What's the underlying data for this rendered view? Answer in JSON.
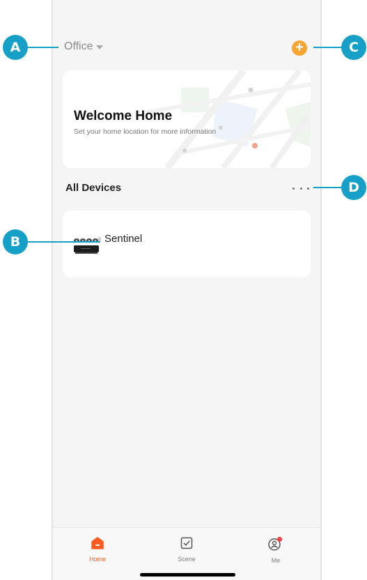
{
  "header": {
    "location_label": "Office"
  },
  "welcome_card": {
    "title": "Welcome Home",
    "subtitle": "Set your home location for more information"
  },
  "devices_section": {
    "title": "All Devices",
    "items": [
      {
        "name": "Sentinel"
      }
    ]
  },
  "tab_bar": {
    "tabs": [
      {
        "label": "Home",
        "icon": "home-icon",
        "active": true
      },
      {
        "label": "Scene",
        "icon": "scene-checkbox-icon",
        "active": false
      },
      {
        "label": "Me",
        "icon": "profile-icon",
        "active": false
      }
    ]
  },
  "callouts": {
    "a": "A",
    "b": "B",
    "c": "C",
    "d": "D"
  },
  "colors": {
    "accent": "#f6a532",
    "active_tab": "#ff5a1f",
    "callout": "#16a0c8",
    "background": "#f5f5f5"
  }
}
